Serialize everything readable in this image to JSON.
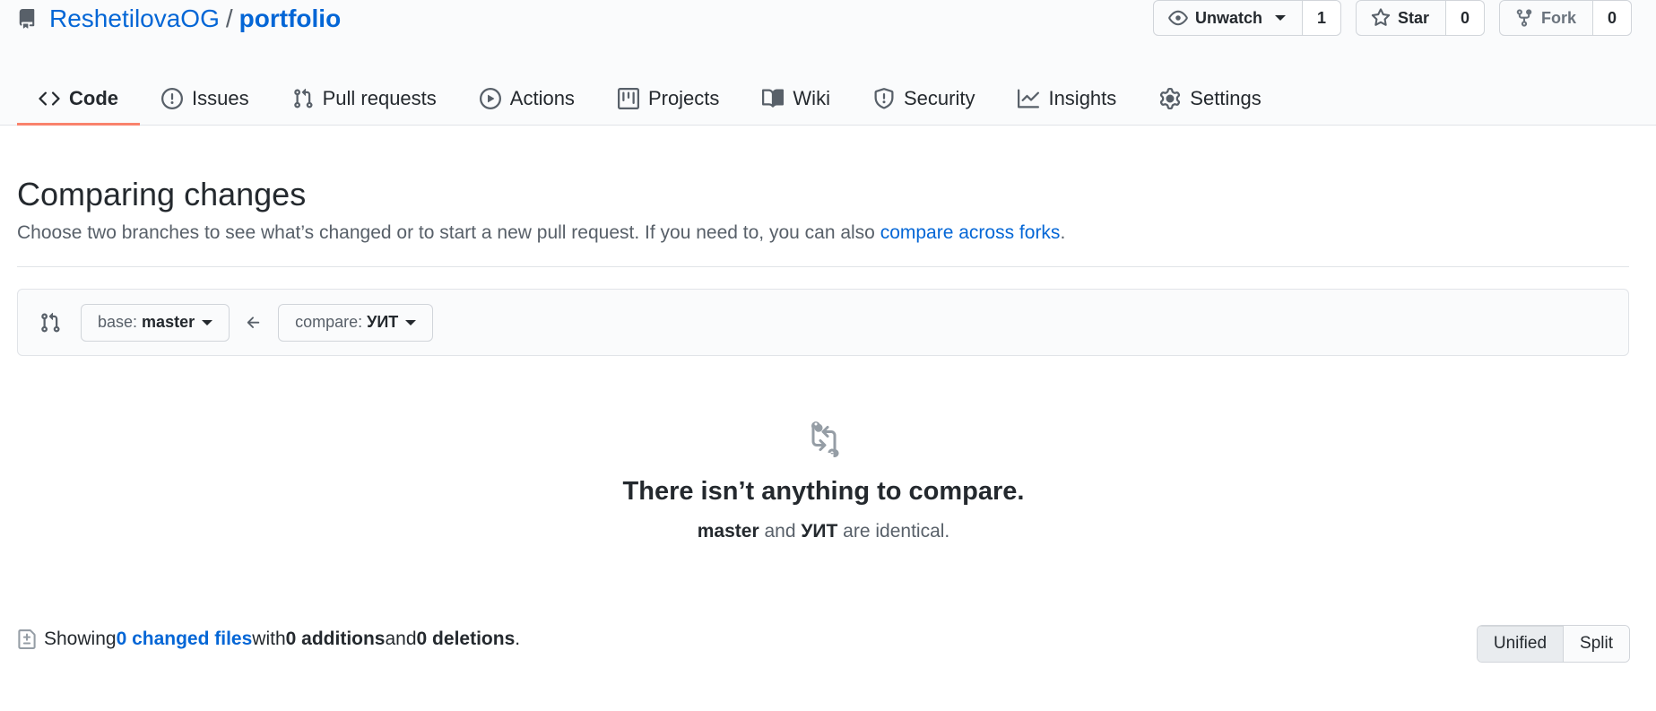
{
  "repo": {
    "owner": "ReshetilovaOG",
    "separator": "/",
    "name": "portfolio"
  },
  "actions": {
    "watch": {
      "label": "Unwatch",
      "count": "1"
    },
    "star": {
      "label": "Star",
      "count": "0"
    },
    "fork": {
      "label": "Fork",
      "count": "0"
    }
  },
  "tabs": [
    {
      "label": "Code",
      "icon": "code-icon",
      "active": true
    },
    {
      "label": "Issues",
      "icon": "issue-icon"
    },
    {
      "label": "Pull requests",
      "icon": "pull-request-icon"
    },
    {
      "label": "Actions",
      "icon": "play-icon"
    },
    {
      "label": "Projects",
      "icon": "project-icon"
    },
    {
      "label": "Wiki",
      "icon": "book-icon"
    },
    {
      "label": "Security",
      "icon": "shield-icon"
    },
    {
      "label": "Insights",
      "icon": "graph-icon"
    },
    {
      "label": "Settings",
      "icon": "gear-icon"
    }
  ],
  "compare": {
    "title": "Comparing changes",
    "description": "Choose two branches to see what’s changed or to start a new pull request. If you need to, you can also ",
    "forks_link": "compare across forks",
    "description_end": ".",
    "base_prefix": "base:",
    "base_branch": "master",
    "compare_prefix": "compare:",
    "compare_branch": "УИТ"
  },
  "blankslate": {
    "title": "There isn’t anything to compare.",
    "branch_a": "master",
    "joiner": " and ",
    "branch_b": "УИТ",
    "suffix": " are identical."
  },
  "toc": {
    "showing": "Showing ",
    "changed_link": "0 changed files",
    "with": " with ",
    "additions": "0 additions",
    "and": " and ",
    "deletions": "0 deletions",
    "end": "."
  },
  "diff_view": {
    "unified": "Unified",
    "split": "Split",
    "selected": "Unified"
  },
  "colors": {
    "link": "#0366d6",
    "tab_underline": "#f9826c",
    "header_bg": "#fafbfc"
  }
}
